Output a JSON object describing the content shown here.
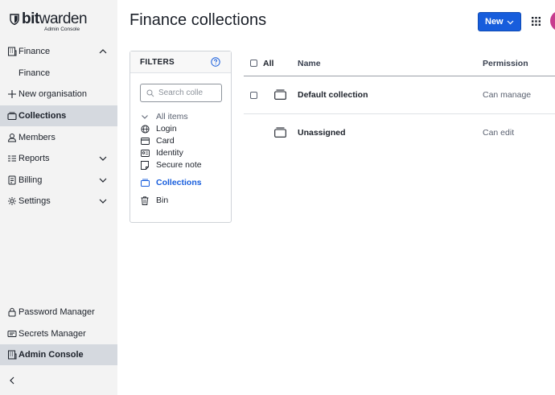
{
  "app": {
    "brand_bold": "bit",
    "brand_rest": "warden",
    "brand_sub": "Admin Console"
  },
  "sidebar": {
    "items": [
      {
        "label": "Finance",
        "icon": "building-icon",
        "expandable": true,
        "expanded": true
      },
      {
        "label": "Finance",
        "sub": true
      },
      {
        "label": "New organisation",
        "icon": "plus-icon"
      },
      {
        "label": "Collections",
        "icon": "collection-icon",
        "active": true
      },
      {
        "label": "Members",
        "icon": "user-icon"
      },
      {
        "label": "Reports",
        "icon": "report-icon",
        "expandable": true
      },
      {
        "label": "Billing",
        "icon": "billing-icon",
        "expandable": true
      },
      {
        "label": "Settings",
        "icon": "gear-icon",
        "expandable": true
      }
    ],
    "products": [
      {
        "label": "Password Manager",
        "icon": "lock-icon"
      },
      {
        "label": "Secrets Manager",
        "icon": "cube-icon"
      },
      {
        "label": "Admin Console",
        "icon": "building-icon",
        "active": true
      }
    ],
    "collapse_icon": "chevron-left-icon"
  },
  "header": {
    "title": "Finance collections",
    "new_button": "New"
  },
  "filters": {
    "title": "FILTERS",
    "search_placeholder": "Search colle",
    "items": [
      {
        "label": "All items",
        "icon": "chevron-down-icon"
      },
      {
        "label": "Login",
        "icon": "globe-icon"
      },
      {
        "label": "Card",
        "icon": "card-icon"
      },
      {
        "label": "Identity",
        "icon": "id-card-icon"
      },
      {
        "label": "Secure note",
        "icon": "note-icon"
      },
      {
        "label": "Collections",
        "icon": "collection-icon",
        "selected": true
      },
      {
        "label": "Bin",
        "icon": "trash-icon"
      }
    ]
  },
  "table": {
    "col_all": "All",
    "col_name": "Name",
    "col_permission": "Permission",
    "rows": [
      {
        "name": "Default collection",
        "permission": "Can manage"
      },
      {
        "name": "Unassigned",
        "permission": "Can edit"
      }
    ]
  },
  "colors": {
    "accent": "#175ddc",
    "sidebar_bg": "#f3f3f3",
    "active_bg": "#d5d9df",
    "avatar": "#c73c8e"
  }
}
